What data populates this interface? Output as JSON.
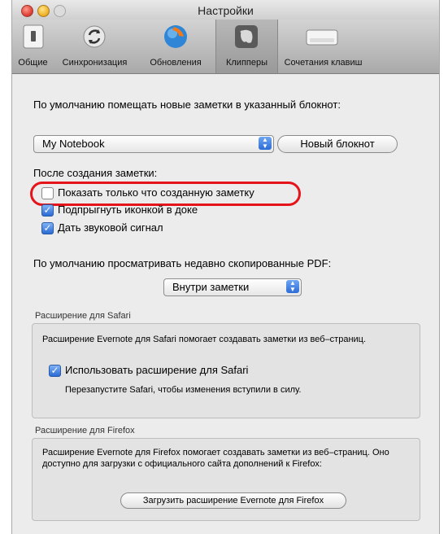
{
  "window": {
    "title": "Настройки"
  },
  "toolbar": {
    "items": [
      {
        "label": "Общие",
        "icon": "light-switch-icon"
      },
      {
        "label": "Синхронизация",
        "icon": "sync-icon"
      },
      {
        "label": "Обновления",
        "icon": "update-globe-icon"
      },
      {
        "label": "Клипперы",
        "icon": "evernote-elephant-icon",
        "selected": true
      },
      {
        "label": "Сочетания клавиш",
        "icon": "keyboard-key-icon"
      }
    ]
  },
  "default_notebook": {
    "label": "По умолчанию помещать новые заметки в указанный блокнот:",
    "selected": "My Notebook",
    "new_notebook_button": "Новый блокнот"
  },
  "after_create": {
    "label": "После создания заметки:",
    "options": [
      {
        "label": "Показать только что созданную заметку",
        "checked": false
      },
      {
        "label": "Подпрыгнуть иконкой в доке",
        "checked": true
      },
      {
        "label": "Дать звуковой сигнал",
        "checked": true
      }
    ]
  },
  "pdf": {
    "label": "По умолчанию просматривать недавно скопированные PDF:",
    "selected": "Внутри заметки"
  },
  "safari": {
    "header": "Расширение для Safari",
    "description": "Расширение Evernote для Safari помогает создавать заметки из веб–страниц.",
    "checkbox_label": "Использовать расширение для Safari",
    "checkbox_checked": true,
    "note": "Перезапустите Safari, чтобы изменения вступили в силу."
  },
  "firefox": {
    "header": "Расширение для Firefox",
    "description": "Расширение Evernote для Firefox помогает создавать заметки из веб–страниц. Оно доступно для загрузки с официального сайта дополнений к Firefox:",
    "button": "Загрузить расширение Evernote для Firefox"
  },
  "colors": {
    "highlight": "#e4141a",
    "accent": "#2a6ad4"
  }
}
